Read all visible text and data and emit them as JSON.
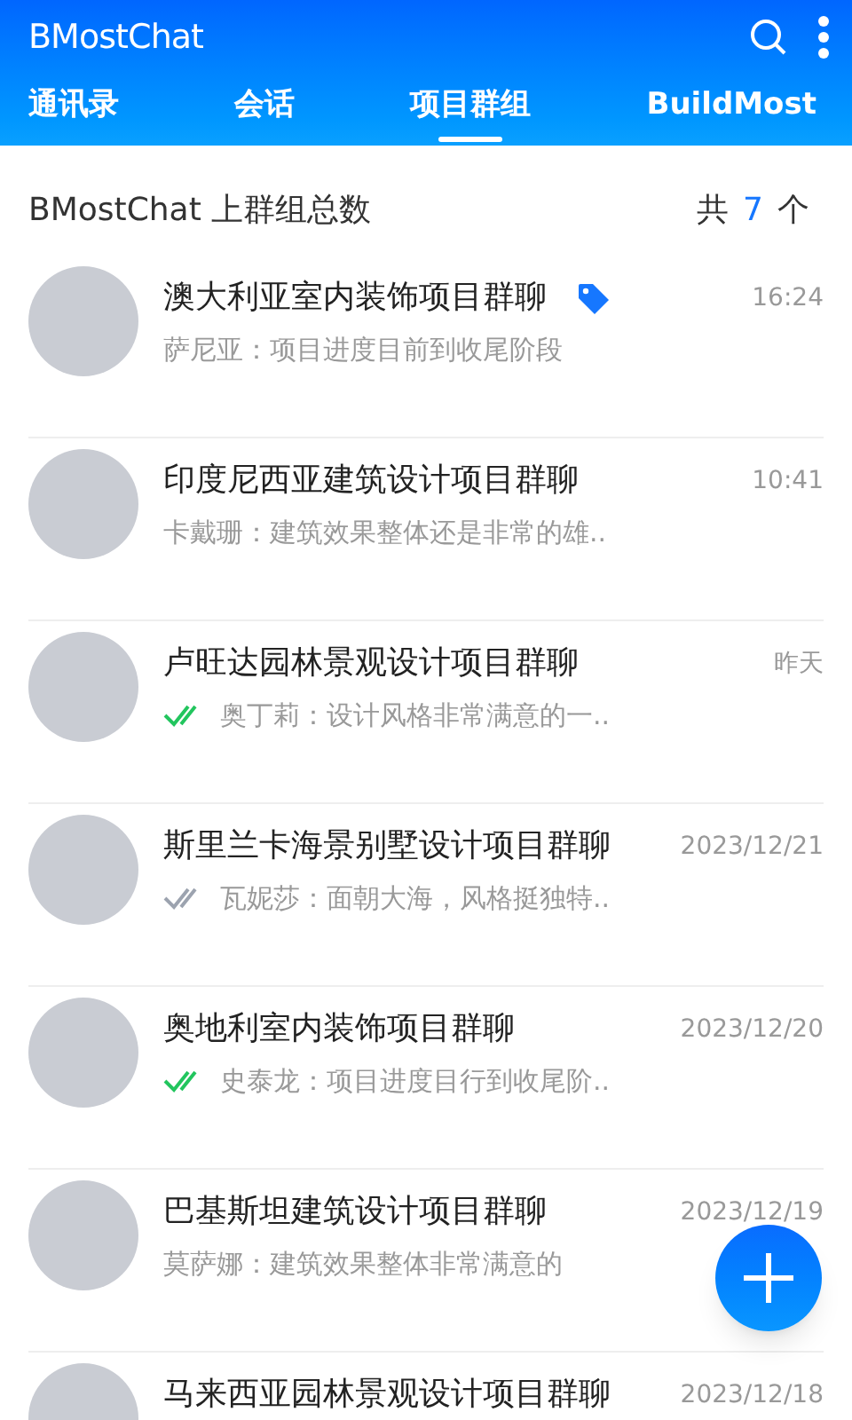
{
  "app_bar": {
    "title": "BMostChat"
  },
  "tabs": [
    {
      "label": "通讯录",
      "selected": false
    },
    {
      "label": "会话",
      "selected": false
    },
    {
      "label": "项目群组",
      "selected": true
    },
    {
      "label": "BuildMost",
      "selected": false
    }
  ],
  "summary": {
    "label": "BMostChat 上群组总数",
    "count_prefix": "共",
    "count": "7",
    "count_suffix": "个"
  },
  "groups": [
    {
      "name": "澳大利亚室内装饰项目群聊",
      "tagged": true,
      "time": "16:24",
      "delivered": false,
      "read": false,
      "preview": "萨尼亚：项目进度目前到收尾阶段"
    },
    {
      "name": "印度尼西亚建筑设计项目群聊",
      "tagged": false,
      "time": "10:41",
      "delivered": false,
      "read": false,
      "preview": "卡戴珊：建筑效果整体还是非常的雄.."
    },
    {
      "name": "卢旺达园林景观设计项目群聊",
      "tagged": false,
      "time": "昨天",
      "delivered": true,
      "read": true,
      "preview": "奥丁莉：设计风格非常满意的一.."
    },
    {
      "name": "斯里兰卡海景别墅设计项目群聊",
      "tagged": false,
      "time": "2023/12/21",
      "delivered": true,
      "read": false,
      "preview": "瓦妮莎：面朝大海，风格挺独特.."
    },
    {
      "name": "奥地利室内装饰项目群聊",
      "tagged": false,
      "time": "2023/12/20",
      "delivered": true,
      "read": true,
      "preview": "史泰龙：项目进度目行到收尾阶.."
    },
    {
      "name": "巴基斯坦建筑设计项目群聊",
      "tagged": false,
      "time": "2023/12/19",
      "delivered": false,
      "read": false,
      "preview": "莫萨娜：建筑效果整体非常满意的"
    },
    {
      "name": "马来西亚园林景观设计项目群聊",
      "tagged": false,
      "time": "2023/12/18",
      "delivered": false,
      "read": false
    }
  ]
}
